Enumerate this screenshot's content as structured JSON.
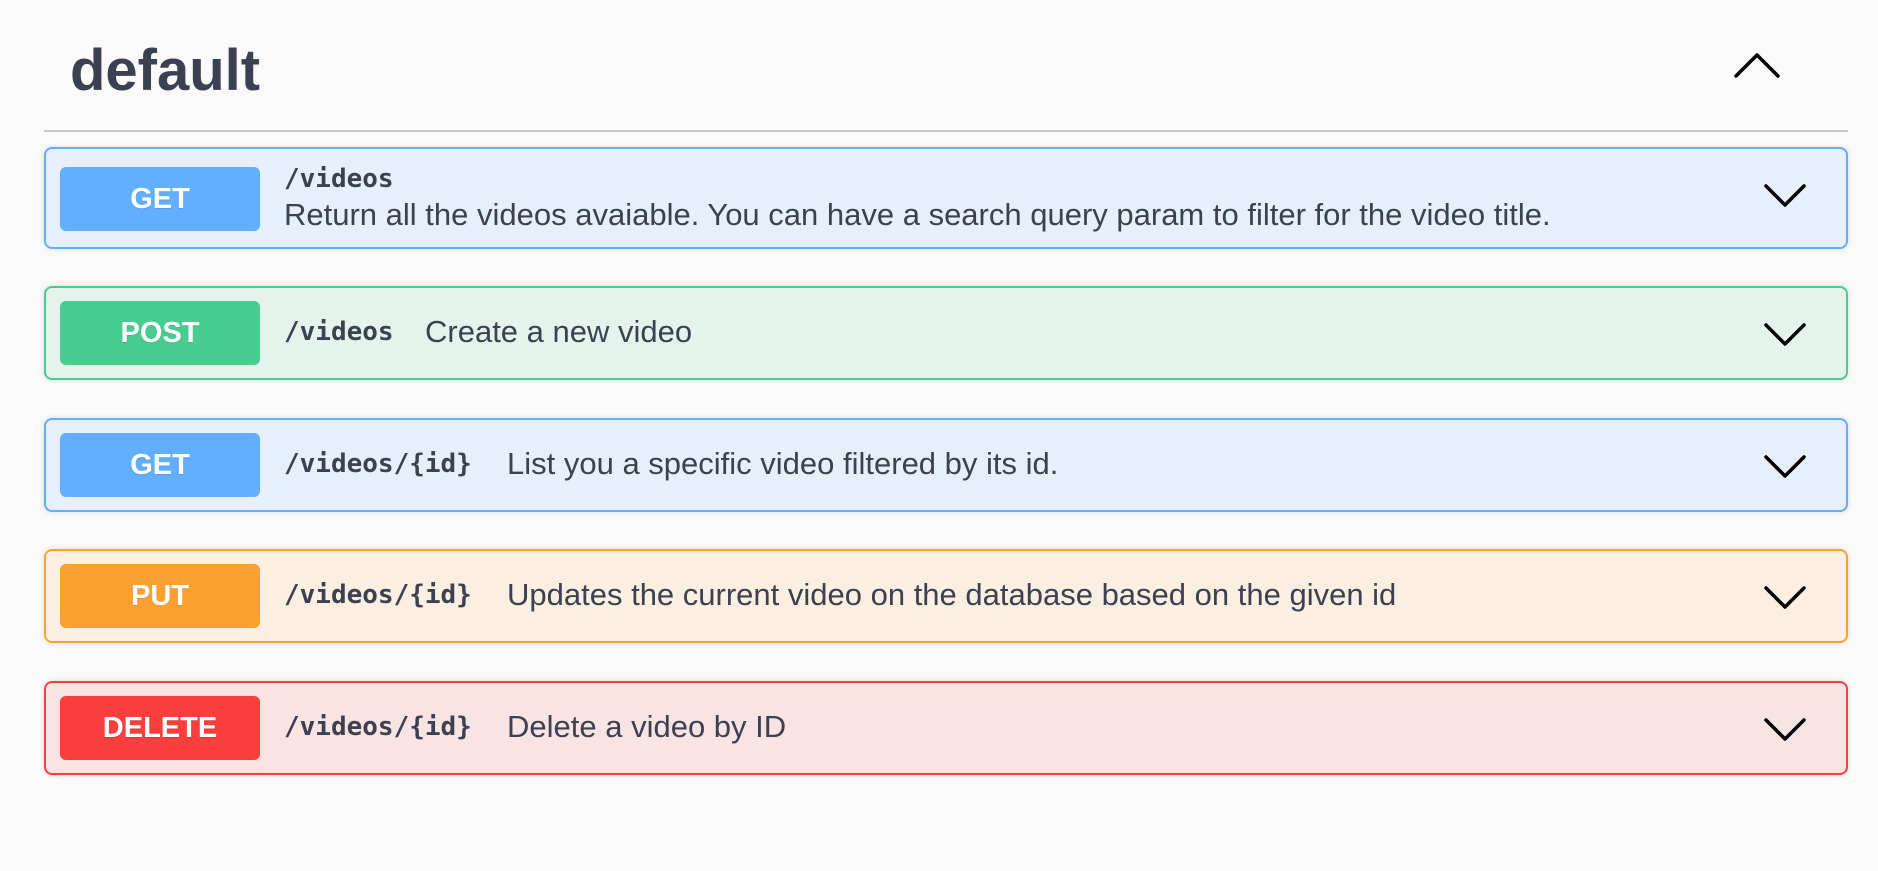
{
  "tag": {
    "title": "default",
    "collapse_icon": "chevron-up-icon"
  },
  "colors": {
    "get": "#61affe",
    "post": "#49cc90",
    "put": "#fca130",
    "delete": "#f93e3e",
    "text": "#3b4151"
  },
  "operations": [
    {
      "method": "GET",
      "path": "/videos",
      "summary": "Return all the videos avaiable. You can have a search query param to filter for the video title.",
      "expand_icon": "chevron-down-icon"
    },
    {
      "method": "POST",
      "path": "/videos",
      "summary": "Create a new video",
      "expand_icon": "chevron-down-icon"
    },
    {
      "method": "GET",
      "path": "/videos/{id}",
      "summary": "List you a specific video filtered by its id.",
      "expand_icon": "chevron-down-icon"
    },
    {
      "method": "PUT",
      "path": "/videos/{id}",
      "summary": "Updates the current video on the database based on the given id",
      "expand_icon": "chevron-down-icon"
    },
    {
      "method": "DELETE",
      "path": "/videos/{id}",
      "summary": "Delete a video by ID",
      "expand_icon": "chevron-down-icon"
    }
  ]
}
